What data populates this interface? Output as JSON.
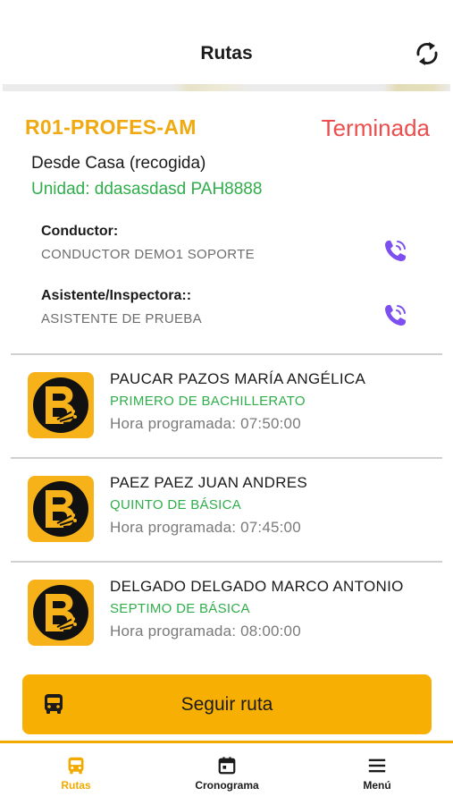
{
  "header": {
    "title": "Rutas",
    "refresh_icon": "refresh-icon"
  },
  "route": {
    "code": "R01-PROFES-AM",
    "status": "Terminada",
    "description": "Desde Casa (recogida)",
    "unit": "Unidad: ddasasdasd PAH8888"
  },
  "staff": [
    {
      "role": "Conductor:",
      "name": "CONDUCTOR DEMO1  SOPORTE",
      "icon": "phone-icon"
    },
    {
      "role": "Asistente/Inspectora::",
      "name": "ASISTENTE DE PRUEBA",
      "icon": "phone-icon"
    }
  ],
  "students": [
    {
      "name": "PAUCAR PAZOS MARÍA ANGÉLICA",
      "grade": "PRIMERO DE BACHILLERATO",
      "time": "Hora programada: 07:50:00"
    },
    {
      "name": "PAEZ PAEZ JUAN ANDRES",
      "grade": "QUINTO DE BÁSICA",
      "time": "Hora programada: 07:45:00"
    },
    {
      "name": "DELGADO DELGADO MARCO ANTONIO",
      "grade": "SEPTIMO DE BÁSICA",
      "time": "Hora programada: 08:00:00"
    }
  ],
  "follow_button": {
    "label": "Seguir ruta",
    "icon": "bus-icon"
  },
  "tabs": [
    {
      "label": "Rutas",
      "icon": "bus-icon",
      "active": true
    },
    {
      "label": "Cronograma",
      "icon": "calendar-icon",
      "active": false
    },
    {
      "label": "Menú",
      "icon": "menu-icon",
      "active": false
    }
  ],
  "colors": {
    "accent": "#f7af04",
    "route_code": "#f0a911",
    "status_finished": "#ec4d4d",
    "green": "#2fae4b",
    "phone": "#7b4ff0"
  }
}
